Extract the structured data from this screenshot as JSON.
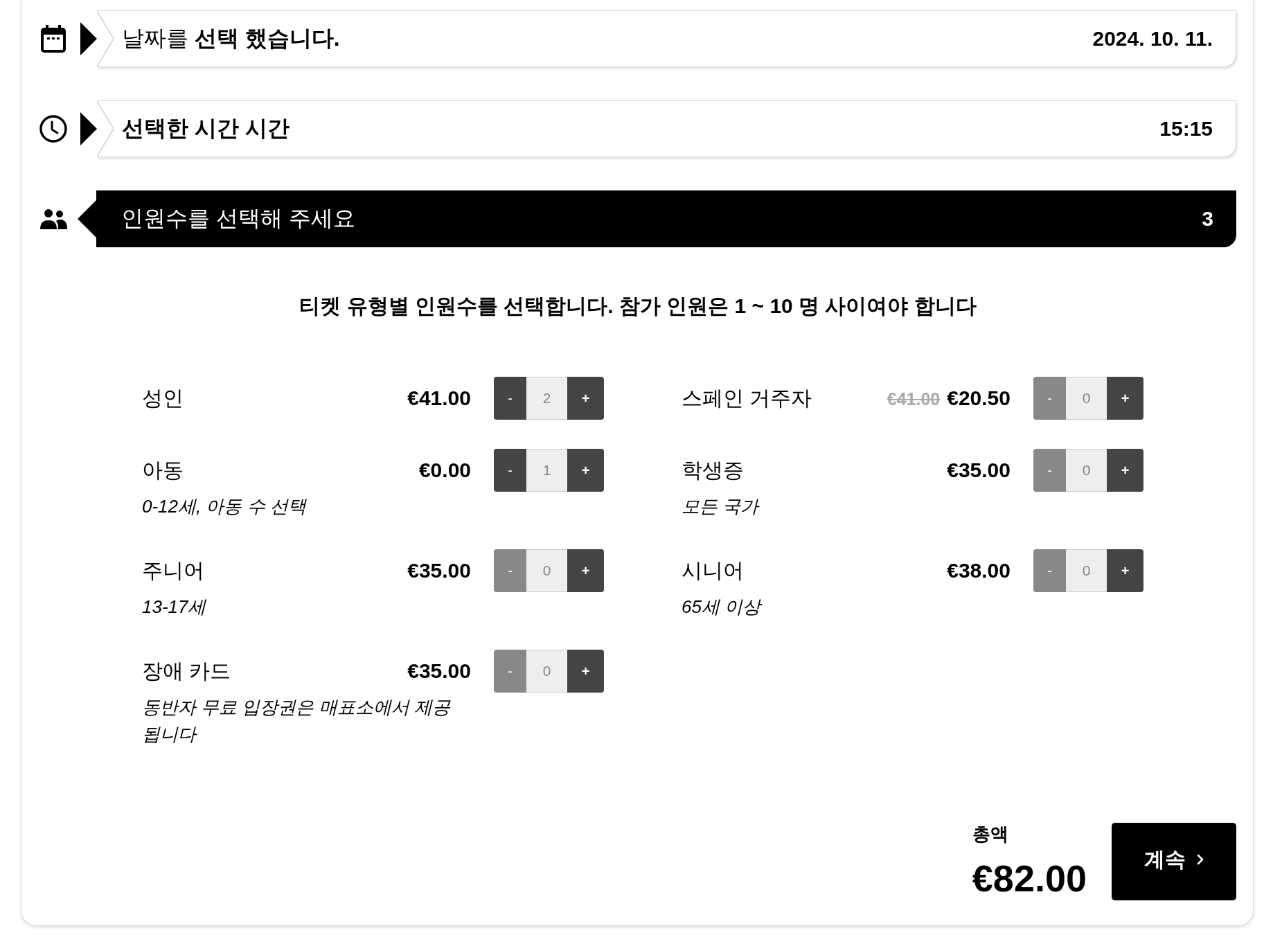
{
  "steps": [
    {
      "kind": "calendar",
      "title": "날짜를 **선택 했습니다.**",
      "bold": false,
      "value": "2024. 10. 11.",
      "active": false
    },
    {
      "kind": "clock",
      "title": "선택한 시간 시간",
      "bold": true,
      "value": "15:15",
      "active": false
    },
    {
      "kind": "people",
      "title": "인원수를 선택해 주세요",
      "bold": false,
      "value": "3",
      "active": true
    }
  ],
  "instruction": "티켓 유형별 인원수를 선택합니다. 참가 인원은 1 ~ 10 명 사이여야 합니다",
  "tickets": [
    {
      "name": "성인",
      "price": "€41.00",
      "count": "2",
      "minus": {
        "label": "-",
        "disabled": false
      },
      "plus": {
        "label": "+"
      }
    },
    {
      "name": "스페인 거주자",
      "original_price": "€41.00",
      "price": "€20.50",
      "count": "0",
      "minus": {
        "label": "-",
        "disabled": true
      },
      "plus": {
        "label": "+"
      }
    },
    {
      "name": "아동",
      "description": "0-12세, 아동 수 선택",
      "price": "€0.00",
      "count": "1",
      "minus": {
        "label": "-",
        "disabled": false
      },
      "plus": {
        "label": "+"
      }
    },
    {
      "name": "학생증",
      "description": "모든 국가",
      "price": "€35.00",
      "count": "0",
      "minus": {
        "label": "-",
        "disabled": true
      },
      "plus": {
        "label": "+"
      }
    },
    {
      "name": "주니어",
      "description": "13-17세",
      "price": "€35.00",
      "count": "0",
      "minus": {
        "label": "-",
        "disabled": true
      },
      "plus": {
        "label": "+"
      }
    },
    {
      "name": "시니어",
      "description": "65세 이상",
      "price": "€38.00",
      "count": "0",
      "minus": {
        "label": "-",
        "disabled": true
      },
      "plus": {
        "label": "+"
      }
    },
    {
      "name": "장애 카드",
      "description": "동반자 무료 입장권은 매표소에서 제공됩니다",
      "price": "€35.00",
      "count": "0",
      "minus": {
        "label": "-",
        "disabled": true
      },
      "plus": {
        "label": "+"
      }
    }
  ],
  "total": {
    "label": "총액",
    "amount": "€82.00"
  },
  "continue_button": {
    "label": "계속"
  }
}
